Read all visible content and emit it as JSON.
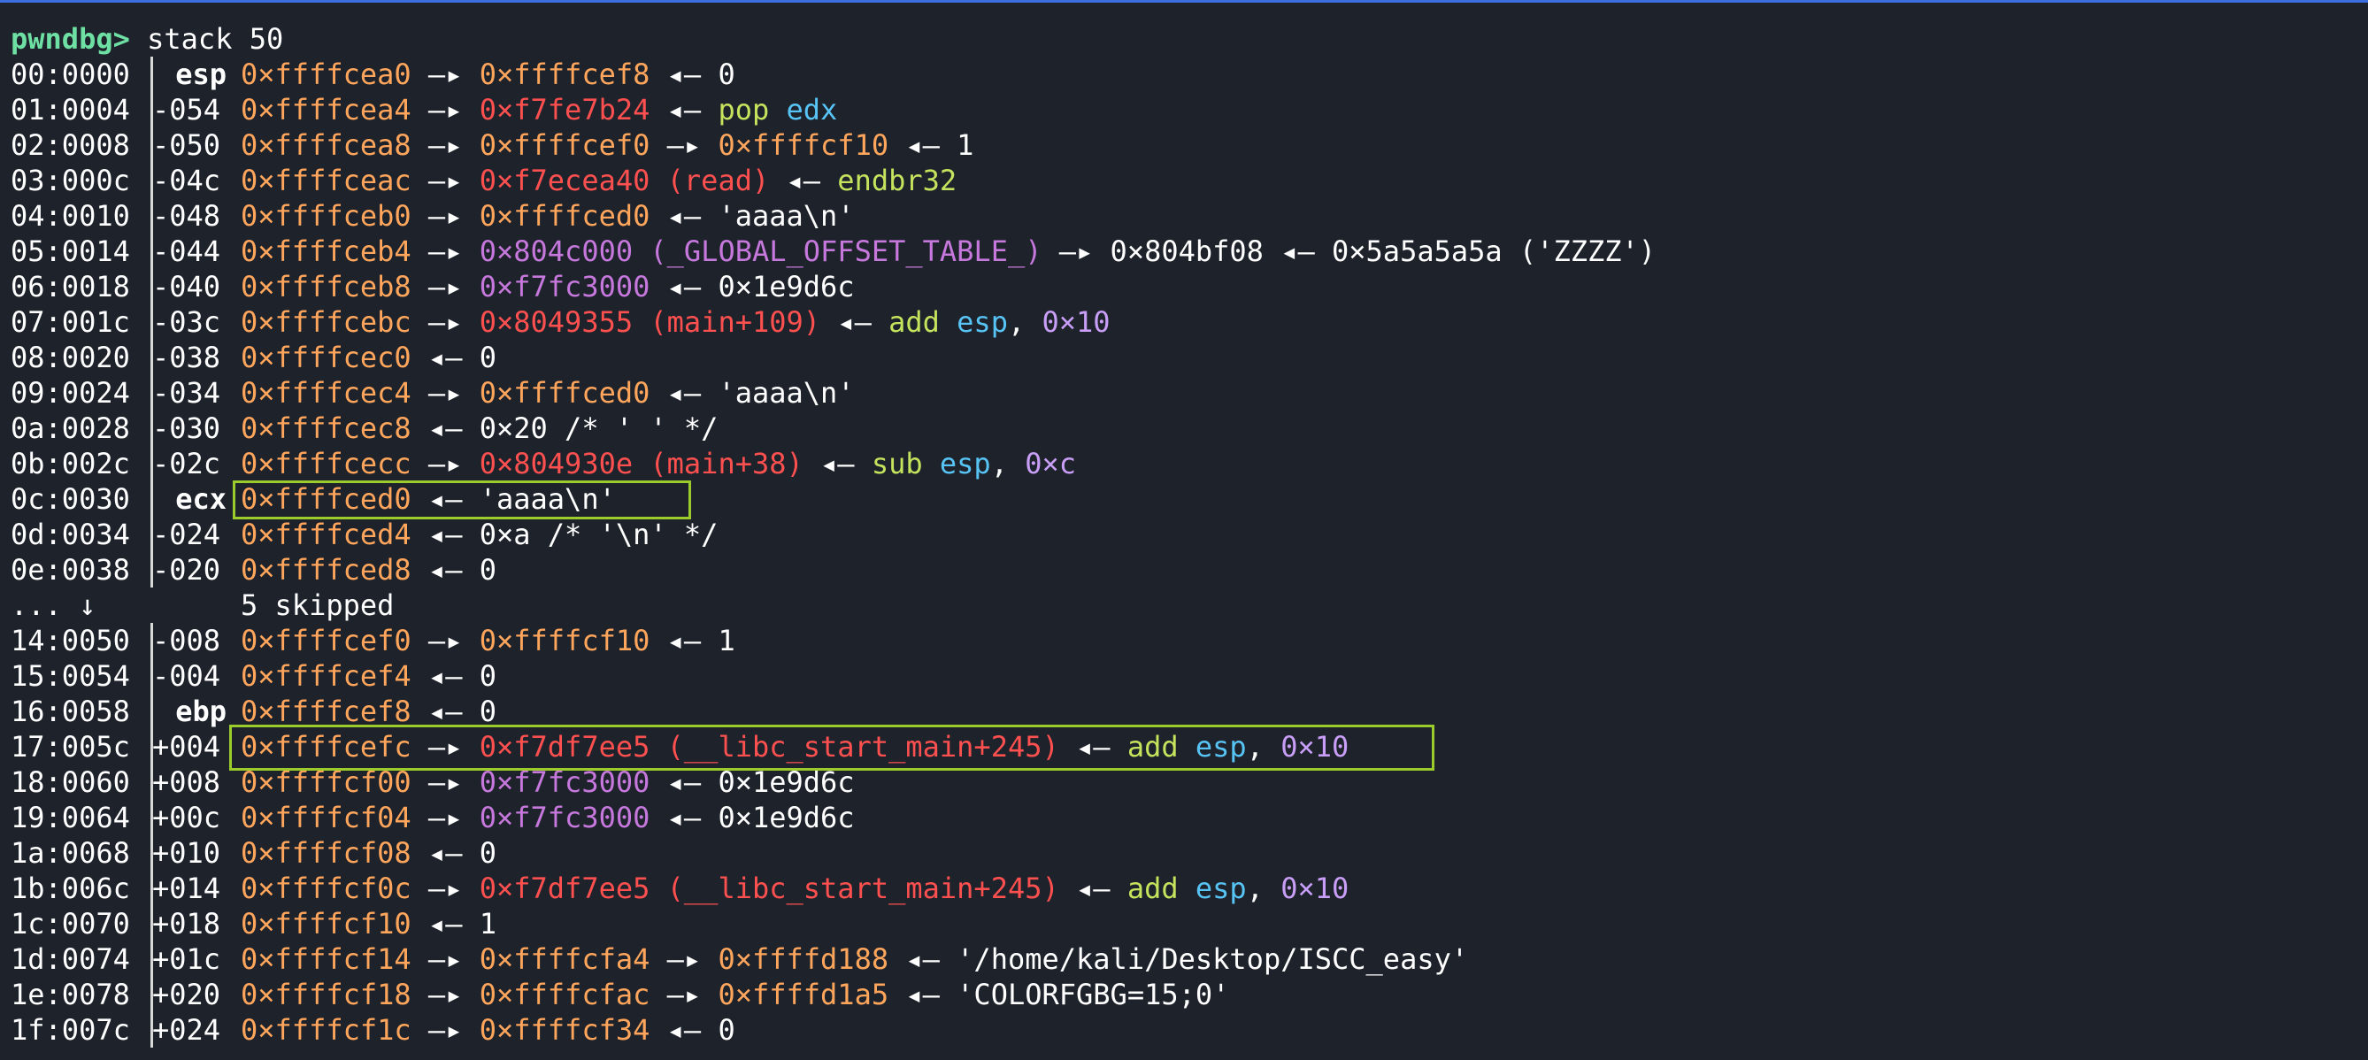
{
  "prompt": {
    "label": "pwndbg>",
    "command": "stack 50"
  },
  "colors": {
    "prompt": "#6ee0a4",
    "stack": "#ffa65c",
    "code": "#ff5050",
    "data": "#c678dd",
    "op": "#c5e35d",
    "reg": "#58c4f5",
    "num": "#c99ef7",
    "highlight": "#9ccc2c"
  },
  "rows": [
    {
      "addr": "00:0000",
      "off": "esp",
      "segs": [
        [
          "stack",
          "0×ffffcea0"
        ],
        [
          "arrow",
          " —▸ "
        ],
        [
          "stack",
          "0×ffffcef8"
        ],
        [
          "arrow",
          " ◂— "
        ],
        [
          "plain",
          "0"
        ]
      ]
    },
    {
      "addr": "01:0004",
      "off": "-054",
      "segs": [
        [
          "stack",
          "0×ffffcea4"
        ],
        [
          "arrow",
          " —▸ "
        ],
        [
          "code",
          "0×f7fe7b24"
        ],
        [
          "arrow",
          " ◂— "
        ],
        [
          "op",
          "pop "
        ],
        [
          "reg",
          "edx"
        ]
      ]
    },
    {
      "addr": "02:0008",
      "off": "-050",
      "segs": [
        [
          "stack",
          "0×ffffcea8"
        ],
        [
          "arrow",
          " —▸ "
        ],
        [
          "stack",
          "0×ffffcef0"
        ],
        [
          "arrow",
          " —▸ "
        ],
        [
          "stack",
          "0×ffffcf10"
        ],
        [
          "arrow",
          " ◂— "
        ],
        [
          "plain",
          "1"
        ]
      ]
    },
    {
      "addr": "03:000c",
      "off": "-04c",
      "segs": [
        [
          "stack",
          "0×ffffceac"
        ],
        [
          "arrow",
          " —▸ "
        ],
        [
          "code",
          "0×f7ecea40 (read)"
        ],
        [
          "arrow",
          " ◂— "
        ],
        [
          "op",
          "endbr32"
        ]
      ]
    },
    {
      "addr": "04:0010",
      "off": "-048",
      "segs": [
        [
          "stack",
          "0×ffffceb0"
        ],
        [
          "arrow",
          " —▸ "
        ],
        [
          "stack",
          "0×ffffced0"
        ],
        [
          "arrow",
          " ◂— "
        ],
        [
          "str",
          "'aaaa\\n'"
        ]
      ]
    },
    {
      "addr": "05:0014",
      "off": "-044",
      "segs": [
        [
          "stack",
          "0×ffffceb4"
        ],
        [
          "arrow",
          " —▸ "
        ],
        [
          "data",
          "0×804c000 (_GLOBAL_OFFSET_TABLE_)"
        ],
        [
          "arrow",
          " —▸ "
        ],
        [
          "plain",
          "0×804bf08"
        ],
        [
          "arrow",
          " ◂— "
        ],
        [
          "plain",
          "0×5a5a5a5a ('ZZZZ')"
        ]
      ]
    },
    {
      "addr": "06:0018",
      "off": "-040",
      "segs": [
        [
          "stack",
          "0×ffffceb8"
        ],
        [
          "arrow",
          " —▸ "
        ],
        [
          "data",
          "0×f7fc3000"
        ],
        [
          "arrow",
          " ◂— "
        ],
        [
          "plain",
          "0×1e9d6c"
        ]
      ]
    },
    {
      "addr": "07:001c",
      "off": "-03c",
      "segs": [
        [
          "stack",
          "0×ffffcebc"
        ],
        [
          "arrow",
          " —▸ "
        ],
        [
          "code",
          "0×8049355 (main+109)"
        ],
        [
          "arrow",
          " ◂— "
        ],
        [
          "op",
          "add "
        ],
        [
          "reg",
          "esp"
        ],
        [
          "plain",
          ", "
        ],
        [
          "num",
          "0×10"
        ]
      ]
    },
    {
      "addr": "08:0020",
      "off": "-038",
      "segs": [
        [
          "stack",
          "0×ffffcec0"
        ],
        [
          "arrow",
          " ◂— "
        ],
        [
          "plain",
          "0"
        ]
      ]
    },
    {
      "addr": "09:0024",
      "off": "-034",
      "segs": [
        [
          "stack",
          "0×ffffcec4"
        ],
        [
          "arrow",
          " —▸ "
        ],
        [
          "stack",
          "0×ffffced0"
        ],
        [
          "arrow",
          " ◂— "
        ],
        [
          "str",
          "'aaaa\\n'"
        ]
      ]
    },
    {
      "addr": "0a:0028",
      "off": "-030",
      "segs": [
        [
          "stack",
          "0×ffffcec8"
        ],
        [
          "arrow",
          " ◂— "
        ],
        [
          "plain",
          "0×20 /* ' ' */"
        ]
      ]
    },
    {
      "addr": "0b:002c",
      "off": "-02c",
      "segs": [
        [
          "stack",
          "0×ffffcecc"
        ],
        [
          "arrow",
          " —▸ "
        ],
        [
          "code",
          "0×804930e (main+38)"
        ],
        [
          "arrow",
          " ◂— "
        ],
        [
          "op",
          "sub "
        ],
        [
          "reg",
          "esp"
        ],
        [
          "plain",
          ", "
        ],
        [
          "num",
          "0×c"
        ]
      ]
    },
    {
      "addr": "0c:0030",
      "off": "ecx",
      "segs": [
        [
          "stack",
          "0×ffffced0"
        ],
        [
          "arrow",
          " ◂— "
        ],
        [
          "str",
          "'aaaa\\n'"
        ]
      ]
    },
    {
      "addr": "0d:0034",
      "off": "-024",
      "segs": [
        [
          "stack",
          "0×ffffced4"
        ],
        [
          "arrow",
          " ◂— "
        ],
        [
          "plain",
          "0×a /* '\\n' */"
        ]
      ]
    },
    {
      "addr": "0e:0038",
      "off": "-020",
      "segs": [
        [
          "stack",
          "0×ffffced8"
        ],
        [
          "arrow",
          " ◂— "
        ],
        [
          "plain",
          "0"
        ]
      ]
    },
    {
      "skip": true,
      "addr": "... ↓",
      "text": "5 skipped"
    },
    {
      "addr": "14:0050",
      "off": "-008",
      "segs": [
        [
          "stack",
          "0×ffffcef0"
        ],
        [
          "arrow",
          " —▸ "
        ],
        [
          "stack",
          "0×ffffcf10"
        ],
        [
          "arrow",
          " ◂— "
        ],
        [
          "plain",
          "1"
        ]
      ]
    },
    {
      "addr": "15:0054",
      "off": "-004",
      "segs": [
        [
          "stack",
          "0×ffffcef4"
        ],
        [
          "arrow",
          " ◂— "
        ],
        [
          "plain",
          "0"
        ]
      ]
    },
    {
      "addr": "16:0058",
      "off": "ebp",
      "segs": [
        [
          "stack",
          "0×ffffcef8"
        ],
        [
          "arrow",
          " ◂— "
        ],
        [
          "plain",
          "0"
        ]
      ]
    },
    {
      "addr": "17:005c",
      "off": "+004",
      "segs": [
        [
          "stack",
          "0×ffffcefc"
        ],
        [
          "arrow",
          " —▸ "
        ],
        [
          "code",
          "0×f7df7ee5 (__libc_start_main+245)"
        ],
        [
          "arrow",
          " ◂— "
        ],
        [
          "op",
          "add "
        ],
        [
          "reg",
          "esp"
        ],
        [
          "plain",
          ", "
        ],
        [
          "num",
          "0×10"
        ]
      ]
    },
    {
      "addr": "18:0060",
      "off": "+008",
      "segs": [
        [
          "stack",
          "0×ffffcf00"
        ],
        [
          "arrow",
          " —▸ "
        ],
        [
          "data",
          "0×f7fc3000"
        ],
        [
          "arrow",
          " ◂— "
        ],
        [
          "plain",
          "0×1e9d6c"
        ]
      ]
    },
    {
      "addr": "19:0064",
      "off": "+00c",
      "segs": [
        [
          "stack",
          "0×ffffcf04"
        ],
        [
          "arrow",
          " —▸ "
        ],
        [
          "data",
          "0×f7fc3000"
        ],
        [
          "arrow",
          " ◂— "
        ],
        [
          "plain",
          "0×1e9d6c"
        ]
      ]
    },
    {
      "addr": "1a:0068",
      "off": "+010",
      "segs": [
        [
          "stack",
          "0×ffffcf08"
        ],
        [
          "arrow",
          " ◂— "
        ],
        [
          "plain",
          "0"
        ]
      ]
    },
    {
      "addr": "1b:006c",
      "off": "+014",
      "segs": [
        [
          "stack",
          "0×ffffcf0c"
        ],
        [
          "arrow",
          " —▸ "
        ],
        [
          "code",
          "0×f7df7ee5 (__libc_start_main+245)"
        ],
        [
          "arrow",
          " ◂— "
        ],
        [
          "op",
          "add "
        ],
        [
          "reg",
          "esp"
        ],
        [
          "plain",
          ", "
        ],
        [
          "num",
          "0×10"
        ]
      ]
    },
    {
      "addr": "1c:0070",
      "off": "+018",
      "segs": [
        [
          "stack",
          "0×ffffcf10"
        ],
        [
          "arrow",
          " ◂— "
        ],
        [
          "plain",
          "1"
        ]
      ]
    },
    {
      "addr": "1d:0074",
      "off": "+01c",
      "segs": [
        [
          "stack",
          "0×ffffcf14"
        ],
        [
          "arrow",
          " —▸ "
        ],
        [
          "stack",
          "0×ffffcfa4"
        ],
        [
          "arrow",
          " —▸ "
        ],
        [
          "stack",
          "0×ffffd188"
        ],
        [
          "arrow",
          " ◂— "
        ],
        [
          "str",
          "'/home/kali/Desktop/ISCC_easy'"
        ]
      ]
    },
    {
      "addr": "1e:0078",
      "off": "+020",
      "segs": [
        [
          "stack",
          "0×ffffcf18"
        ],
        [
          "arrow",
          " —▸ "
        ],
        [
          "stack",
          "0×ffffcfac"
        ],
        [
          "arrow",
          " —▸ "
        ],
        [
          "stack",
          "0×ffffd1a5"
        ],
        [
          "arrow",
          " ◂— "
        ],
        [
          "str",
          "'COLORFGBG=15;0'"
        ]
      ]
    },
    {
      "addr": "1f:007c",
      "off": "+024",
      "segs": [
        [
          "stack",
          "0×ffffcf1c"
        ],
        [
          "arrow",
          " —▸ "
        ],
        [
          "stack",
          "0×ffffcf34"
        ],
        [
          "arrow",
          " ◂— "
        ],
        [
          "plain",
          "0"
        ]
      ]
    }
  ]
}
